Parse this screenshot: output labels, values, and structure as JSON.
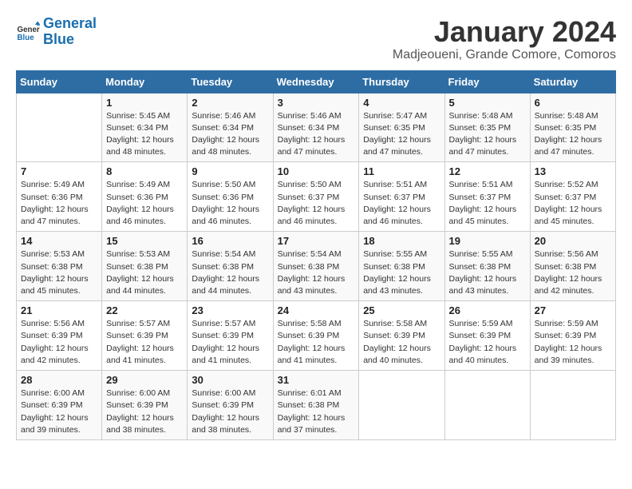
{
  "logo": {
    "line1": "General",
    "line2": "Blue"
  },
  "title": "January 2024",
  "subtitle": "Madjeoueni, Grande Comore, Comoros",
  "days_of_week": [
    "Sunday",
    "Monday",
    "Tuesday",
    "Wednesday",
    "Thursday",
    "Friday",
    "Saturday"
  ],
  "weeks": [
    [
      {
        "day": "",
        "info": ""
      },
      {
        "day": "1",
        "info": "Sunrise: 5:45 AM\nSunset: 6:34 PM\nDaylight: 12 hours\nand 48 minutes."
      },
      {
        "day": "2",
        "info": "Sunrise: 5:46 AM\nSunset: 6:34 PM\nDaylight: 12 hours\nand 48 minutes."
      },
      {
        "day": "3",
        "info": "Sunrise: 5:46 AM\nSunset: 6:34 PM\nDaylight: 12 hours\nand 47 minutes."
      },
      {
        "day": "4",
        "info": "Sunrise: 5:47 AM\nSunset: 6:35 PM\nDaylight: 12 hours\nand 47 minutes."
      },
      {
        "day": "5",
        "info": "Sunrise: 5:48 AM\nSunset: 6:35 PM\nDaylight: 12 hours\nand 47 minutes."
      },
      {
        "day": "6",
        "info": "Sunrise: 5:48 AM\nSunset: 6:35 PM\nDaylight: 12 hours\nand 47 minutes."
      }
    ],
    [
      {
        "day": "7",
        "info": "Sunrise: 5:49 AM\nSunset: 6:36 PM\nDaylight: 12 hours\nand 47 minutes."
      },
      {
        "day": "8",
        "info": "Sunrise: 5:49 AM\nSunset: 6:36 PM\nDaylight: 12 hours\nand 46 minutes."
      },
      {
        "day": "9",
        "info": "Sunrise: 5:50 AM\nSunset: 6:36 PM\nDaylight: 12 hours\nand 46 minutes."
      },
      {
        "day": "10",
        "info": "Sunrise: 5:50 AM\nSunset: 6:37 PM\nDaylight: 12 hours\nand 46 minutes."
      },
      {
        "day": "11",
        "info": "Sunrise: 5:51 AM\nSunset: 6:37 PM\nDaylight: 12 hours\nand 46 minutes."
      },
      {
        "day": "12",
        "info": "Sunrise: 5:51 AM\nSunset: 6:37 PM\nDaylight: 12 hours\nand 45 minutes."
      },
      {
        "day": "13",
        "info": "Sunrise: 5:52 AM\nSunset: 6:37 PM\nDaylight: 12 hours\nand 45 minutes."
      }
    ],
    [
      {
        "day": "14",
        "info": "Sunrise: 5:53 AM\nSunset: 6:38 PM\nDaylight: 12 hours\nand 45 minutes."
      },
      {
        "day": "15",
        "info": "Sunrise: 5:53 AM\nSunset: 6:38 PM\nDaylight: 12 hours\nand 44 minutes."
      },
      {
        "day": "16",
        "info": "Sunrise: 5:54 AM\nSunset: 6:38 PM\nDaylight: 12 hours\nand 44 minutes."
      },
      {
        "day": "17",
        "info": "Sunrise: 5:54 AM\nSunset: 6:38 PM\nDaylight: 12 hours\nand 43 minutes."
      },
      {
        "day": "18",
        "info": "Sunrise: 5:55 AM\nSunset: 6:38 PM\nDaylight: 12 hours\nand 43 minutes."
      },
      {
        "day": "19",
        "info": "Sunrise: 5:55 AM\nSunset: 6:38 PM\nDaylight: 12 hours\nand 43 minutes."
      },
      {
        "day": "20",
        "info": "Sunrise: 5:56 AM\nSunset: 6:38 PM\nDaylight: 12 hours\nand 42 minutes."
      }
    ],
    [
      {
        "day": "21",
        "info": "Sunrise: 5:56 AM\nSunset: 6:39 PM\nDaylight: 12 hours\nand 42 minutes."
      },
      {
        "day": "22",
        "info": "Sunrise: 5:57 AM\nSunset: 6:39 PM\nDaylight: 12 hours\nand 41 minutes."
      },
      {
        "day": "23",
        "info": "Sunrise: 5:57 AM\nSunset: 6:39 PM\nDaylight: 12 hours\nand 41 minutes."
      },
      {
        "day": "24",
        "info": "Sunrise: 5:58 AM\nSunset: 6:39 PM\nDaylight: 12 hours\nand 41 minutes."
      },
      {
        "day": "25",
        "info": "Sunrise: 5:58 AM\nSunset: 6:39 PM\nDaylight: 12 hours\nand 40 minutes."
      },
      {
        "day": "26",
        "info": "Sunrise: 5:59 AM\nSunset: 6:39 PM\nDaylight: 12 hours\nand 40 minutes."
      },
      {
        "day": "27",
        "info": "Sunrise: 5:59 AM\nSunset: 6:39 PM\nDaylight: 12 hours\nand 39 minutes."
      }
    ],
    [
      {
        "day": "28",
        "info": "Sunrise: 6:00 AM\nSunset: 6:39 PM\nDaylight: 12 hours\nand 39 minutes."
      },
      {
        "day": "29",
        "info": "Sunrise: 6:00 AM\nSunset: 6:39 PM\nDaylight: 12 hours\nand 38 minutes."
      },
      {
        "day": "30",
        "info": "Sunrise: 6:00 AM\nSunset: 6:39 PM\nDaylight: 12 hours\nand 38 minutes."
      },
      {
        "day": "31",
        "info": "Sunrise: 6:01 AM\nSunset: 6:38 PM\nDaylight: 12 hours\nand 37 minutes."
      },
      {
        "day": "",
        "info": ""
      },
      {
        "day": "",
        "info": ""
      },
      {
        "day": "",
        "info": ""
      }
    ]
  ]
}
